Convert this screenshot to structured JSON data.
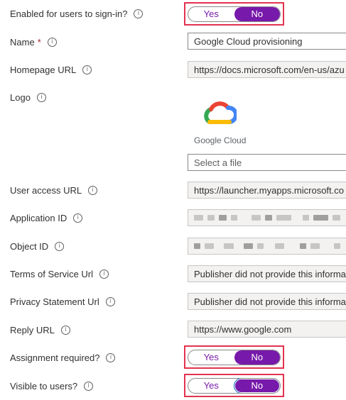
{
  "form": {
    "enabled": {
      "label": "Enabled for users to sign-in?",
      "yes": "Yes",
      "no": "No",
      "selected": "No"
    },
    "name": {
      "label": "Name",
      "required_mark": "*",
      "value": "Google Cloud provisioning"
    },
    "homepage": {
      "label": "Homepage URL",
      "value": "https://docs.microsoft.com/en-us/azu"
    },
    "logo": {
      "label": "Logo",
      "logo_text": "Google Cloud",
      "file_placeholder": "Select a file"
    },
    "user_access": {
      "label": "User access URL",
      "value": "https://launcher.myapps.microsoft.co"
    },
    "application_id": {
      "label": "Application ID"
    },
    "object_id": {
      "label": "Object ID"
    },
    "terms": {
      "label": "Terms of Service Url",
      "value": "Publisher did not provide this informa"
    },
    "privacy": {
      "label": "Privacy Statement Url",
      "value": "Publisher did not provide this informa"
    },
    "reply": {
      "label": "Reply URL",
      "value": "https://www.google.com"
    },
    "assignment": {
      "label": "Assignment required?",
      "yes": "Yes",
      "no": "No",
      "selected": "No"
    },
    "visible": {
      "label": "Visible to users?",
      "yes": "Yes",
      "no": "No",
      "selected": "No"
    }
  },
  "icons": {
    "info": "info-circle-icon",
    "logo": "google-cloud-logo"
  },
  "colors": {
    "accent": "#7719aa",
    "highlight": "#e3324f",
    "required": "#a4262c"
  }
}
